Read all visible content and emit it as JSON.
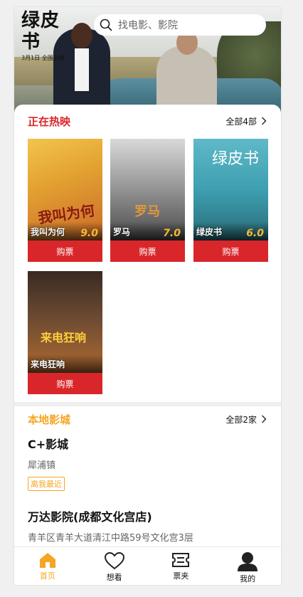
{
  "search": {
    "placeholder": "找电影、影院"
  },
  "hero": {
    "logo_title": "绿皮书",
    "logo_sub": "3月1日 全国上映"
  },
  "now_showing": {
    "title": "正在热映",
    "more_label": "全部4部",
    "title_color": "#d9262a",
    "movies": [
      {
        "name": "我叫为何",
        "score": "9.0",
        "poster_text": "我叫为何",
        "buy_label": "购票"
      },
      {
        "name": "罗马",
        "score": "7.0",
        "poster_text": "罗马",
        "buy_label": "购票"
      },
      {
        "name": "绿皮书",
        "score": "6.0",
        "poster_text": "绿皮书",
        "buy_label": "购票"
      },
      {
        "name": "来电狂响",
        "score": "",
        "poster_text": "来电狂响",
        "buy_label": "购票"
      }
    ]
  },
  "local_cinemas": {
    "title": "本地影城",
    "more_label": "全部2家",
    "title_color": "#f5a623",
    "cinemas": [
      {
        "name": "C+影城",
        "address": "犀浦镇",
        "tag": "离我最近"
      },
      {
        "name": "万达影院(成都文化宫店)",
        "address": "青羊区青羊大道清江中路59号文化宫3层"
      }
    ]
  },
  "tabbar": {
    "active_color": "#f5a623",
    "items": [
      {
        "label": "首页",
        "icon": "home-icon",
        "active": true
      },
      {
        "label": "想看",
        "icon": "heart-icon",
        "active": false
      },
      {
        "label": "票夹",
        "icon": "ticket-icon",
        "active": false
      },
      {
        "label": "我的",
        "icon": "user-icon",
        "active": false
      }
    ]
  }
}
